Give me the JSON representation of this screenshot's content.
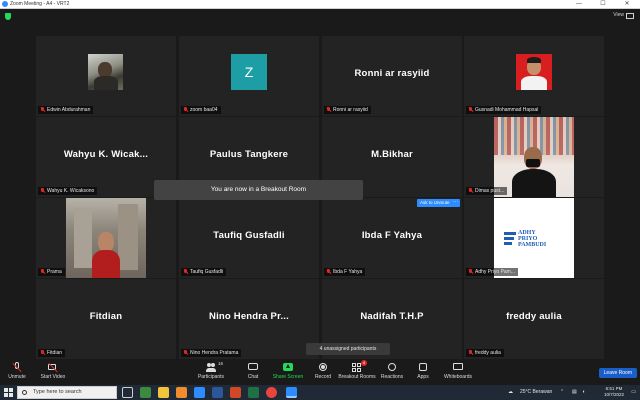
{
  "window": {
    "title": "Zoom Meeting - A4 - VRT2",
    "minimize": "—",
    "maximize": "☐",
    "close": "✕"
  },
  "view_toggle": {
    "label": "View"
  },
  "tiles": [
    {
      "display": "",
      "label": "Edwin Abdurahman",
      "avatar": "photo-man-outdoor"
    },
    {
      "display": "",
      "label": "zoom baa04",
      "avatar_letter": "Z",
      "avatar_color": "#1d9ea4"
    },
    {
      "display": "Ronni ar rasyiid",
      "label": "Ronni ar rasyiid"
    },
    {
      "display": "",
      "label": "Gusnadi Mohammad Hapsal",
      "avatar": "photo-red-background"
    },
    {
      "display": "Wahyu K. Wicak...",
      "label": "Wahyu K. Wicaksono"
    },
    {
      "display": "Paulus Tangkere",
      "label": ""
    },
    {
      "display": "M.Bikhar",
      "label": ""
    },
    {
      "display": "",
      "label": "Dimas pust...",
      "avatar": "video-person-mask"
    },
    {
      "display": "",
      "label": "Prama",
      "avatar": "photo-street"
    },
    {
      "display": "Taufiq Gusfadli",
      "label": "Taufiq Gusfadli"
    },
    {
      "display": "Ibda F Yahya",
      "label": "Ibda F Yahya"
    },
    {
      "display": "",
      "label": "Adhy Priyo Pam...",
      "avatar": "logo-adhy"
    },
    {
      "display": "Fitdian",
      "label": "Fitdian"
    },
    {
      "display": "Nino Hendra Pr...",
      "label": "Nino Hendra Pratama"
    },
    {
      "display": "Nadifah T.H.P",
      "label": ""
    },
    {
      "display": "freddy aulia",
      "label": "freddy aulia"
    }
  ],
  "logo_text": {
    "line1": "ADHY",
    "line2": "PRIYO",
    "line3": "PAMBUDI"
  },
  "toast": "You are now in a Breakout Room",
  "ask_unmute": "Ask to Unmute",
  "more": "···",
  "unassigned": "4 unassigned participants",
  "toolbar": {
    "unmute": "Unmute",
    "start_video": "Start Video",
    "participants": "Participants",
    "participants_count": "16",
    "chat": "Chat",
    "share_screen": "Share Screen",
    "record": "Record",
    "breakout_rooms": "Breakout Rooms",
    "breakout_badge": "4",
    "reactions": "Reactions",
    "apps": "Apps",
    "whiteboards": "Whiteboards",
    "leave": "Leave Room"
  },
  "taskbar": {
    "search_placeholder": "Type here to search",
    "weather": "25°C Berawan",
    "time": "6:51 PM",
    "date": "10/7/2022"
  },
  "colors": {
    "accent": "#2d8cff",
    "share_green": "#23d959",
    "mic_red": "#e02828",
    "tile_bg": "#232323",
    "leave_blue": "#1a5fc9"
  }
}
